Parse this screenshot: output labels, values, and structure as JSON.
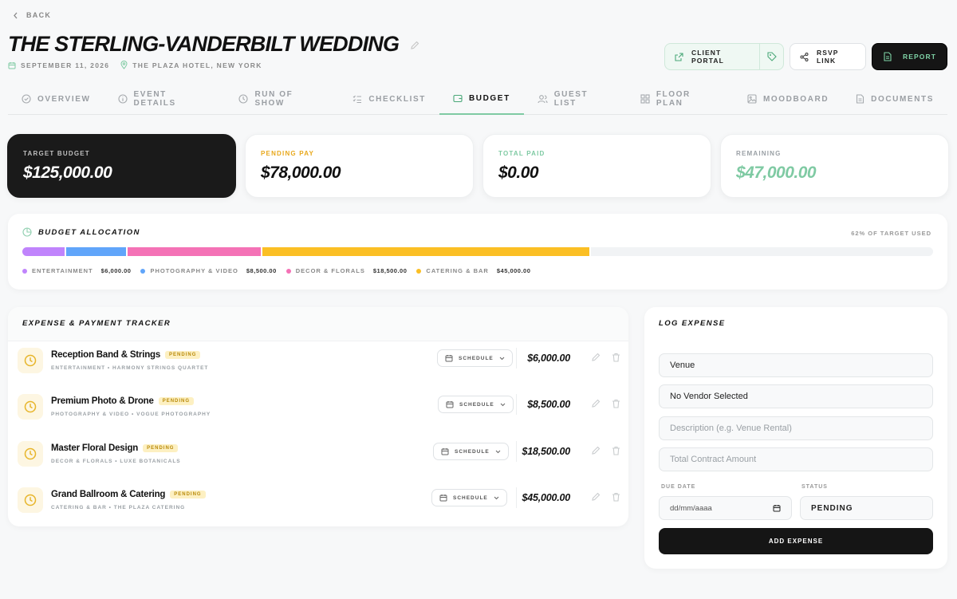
{
  "header": {
    "back_label": "Back",
    "title": "The Sterling-Vanderbilt Wedding",
    "date": "September 11, 2026",
    "location": "The Plaza Hotel, New York",
    "buttons": {
      "client_portal": "Client Portal",
      "rsvp_link": "RSVP Link",
      "report": "Report"
    }
  },
  "tabs": [
    {
      "label": "Overview",
      "icon": "check-circle-icon",
      "active": false
    },
    {
      "label": "Event Details",
      "icon": "info-icon",
      "active": false
    },
    {
      "label": "Run of Show",
      "icon": "clock-icon",
      "active": false
    },
    {
      "label": "Checklist",
      "icon": "list-check-icon",
      "active": false
    },
    {
      "label": "Budget",
      "icon": "wallet-icon",
      "active": true
    },
    {
      "label": "Guest List",
      "icon": "users-icon",
      "active": false
    },
    {
      "label": "Floor Plan",
      "icon": "grid-icon",
      "active": false
    },
    {
      "label": "Moodboard",
      "icon": "image-icon",
      "active": false
    },
    {
      "label": "Documents",
      "icon": "document-icon",
      "active": false
    }
  ],
  "stats": {
    "target": {
      "label": "Target Budget",
      "value": "$125,000.00"
    },
    "pending": {
      "label": "Pending Pay",
      "value": "$78,000.00",
      "color": "#e8a81c"
    },
    "paid": {
      "label": "Total Paid",
      "value": "$0.00",
      "color": "#7fcaa3"
    },
    "remaining": {
      "label": "Remaining",
      "value": "$47,000.00",
      "color": "#7fcaa3"
    }
  },
  "allocation": {
    "title": "Budget Allocation",
    "used_label": "62% of target used",
    "used_fraction": 0.62,
    "segments": [
      {
        "label": "Entertainment",
        "amount": "$6,000.00",
        "fraction": 0.048,
        "color": "#c084fc"
      },
      {
        "label": "Photography & Video",
        "amount": "$8,500.00",
        "fraction": 0.068,
        "color": "#60a5fa"
      },
      {
        "label": "Decor & Florals",
        "amount": "$18,500.00",
        "fraction": 0.148,
        "color": "#f472b6"
      },
      {
        "label": "Catering & Bar",
        "amount": "$45,000.00",
        "fraction": 0.36,
        "color": "#fbbf24"
      }
    ]
  },
  "tracker": {
    "title": "Expense & Payment Tracker",
    "rows": [
      {
        "name": "Reception Band & Strings",
        "status": "Pending",
        "sub": "Entertainment • Harmony Strings Quartet",
        "action": "Schedule",
        "amount": "$6,000.00"
      },
      {
        "name": "Premium Photo & Drone",
        "status": "Pending",
        "sub": "Photography & Video • Vogue Photography",
        "action": "Schedule",
        "amount": "$8,500.00"
      },
      {
        "name": "Master Floral Design",
        "status": "Pending",
        "sub": "Decor & Florals • Luxe Botanicals",
        "action": "Schedule",
        "amount": "$18,500.00"
      },
      {
        "name": "Grand Ballroom & Catering",
        "status": "Pending",
        "sub": "Catering & Bar • The Plaza Catering",
        "action": "Schedule",
        "amount": "$45,000.00"
      }
    ]
  },
  "logform": {
    "title": "Log Expense",
    "category_value": "Venue",
    "vendor_value": "No Vendor Selected",
    "description_placeholder": "Description (e.g. Venue Rental)",
    "amount_placeholder": "Total Contract Amount",
    "due_date_label": "Due Date",
    "due_date_placeholder": "dd/mm/aaaa",
    "status_label": "Status",
    "status_value": "PENDING",
    "add_button": "Add Expense"
  }
}
